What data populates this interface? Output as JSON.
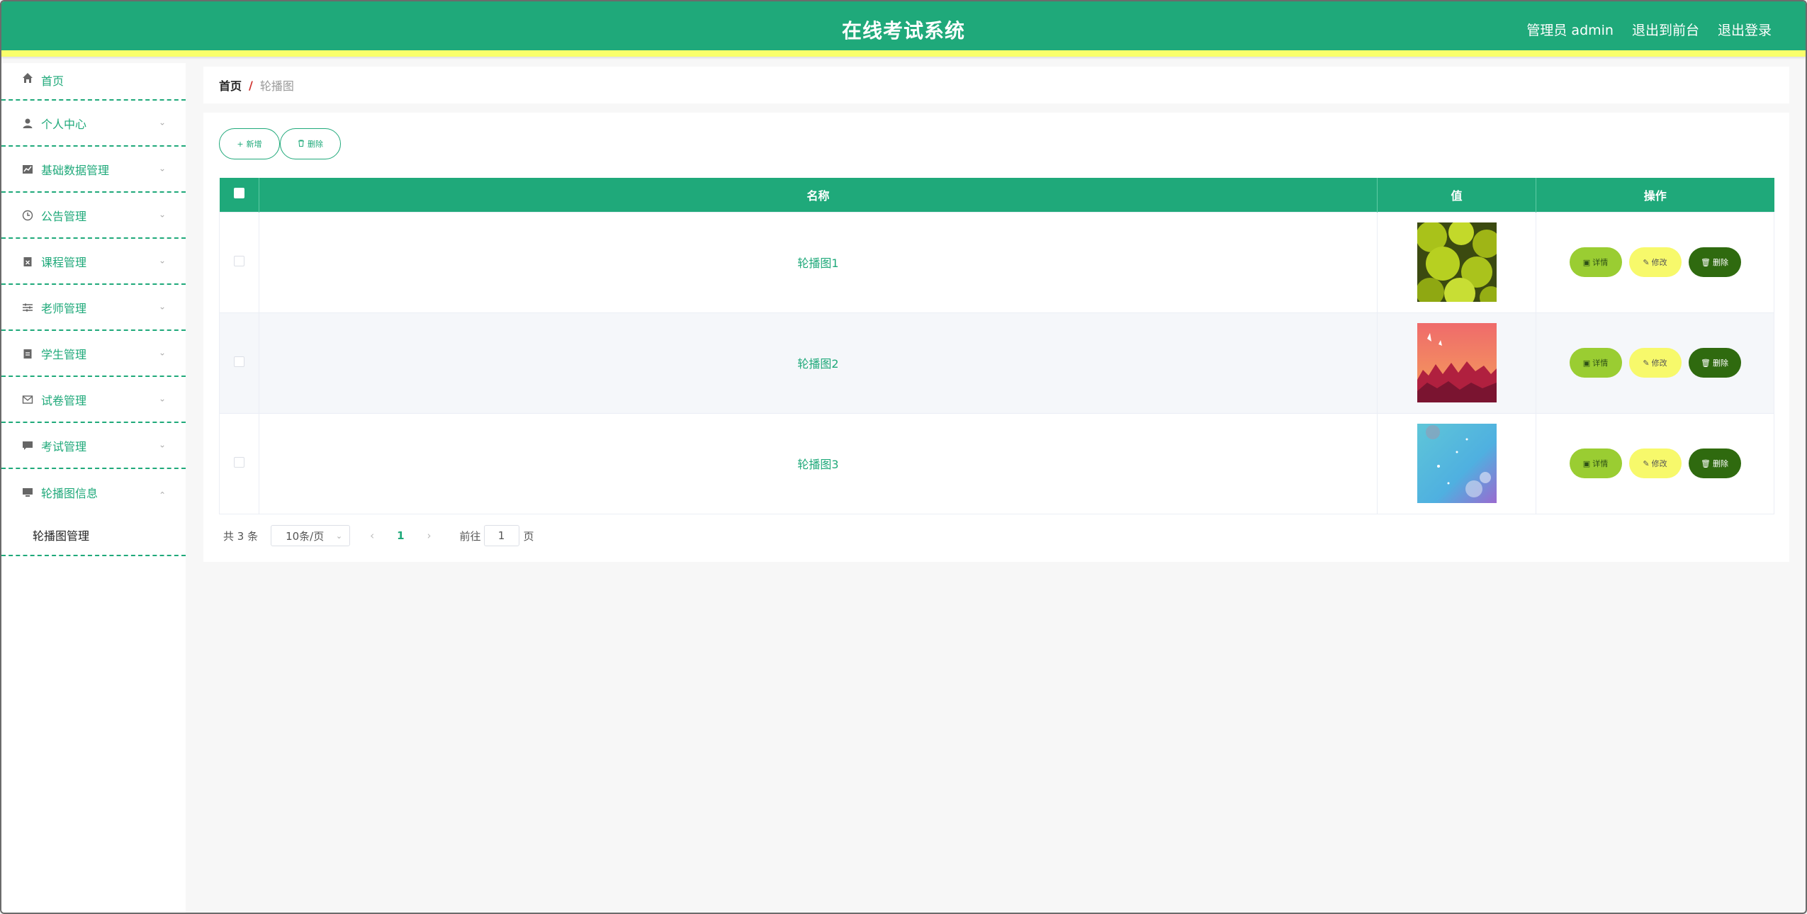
{
  "header": {
    "title": "在线考试系统",
    "user": "管理员 admin",
    "to_front": "退出到前台",
    "logout": "退出登录"
  },
  "colors": {
    "primary": "#1fa97a",
    "accent_strip": "#f9ff6b",
    "detail_btn": "#9acd32",
    "edit_btn": "#f7f96b",
    "delete_btn": "#2f6a0f"
  },
  "sidebar": {
    "items": [
      {
        "label": "首页",
        "icon": "home-icon"
      },
      {
        "label": "个人中心",
        "icon": "user-icon"
      },
      {
        "label": "基础数据管理",
        "icon": "chart-icon"
      },
      {
        "label": "公告管理",
        "icon": "clock-icon"
      },
      {
        "label": "课程管理",
        "icon": "clipboard-x-icon"
      },
      {
        "label": "老师管理",
        "icon": "sliders-icon"
      },
      {
        "label": "学生管理",
        "icon": "clipboard-icon"
      },
      {
        "label": "试卷管理",
        "icon": "mail-icon"
      },
      {
        "label": "考试管理",
        "icon": "chat-icon"
      },
      {
        "label": "轮播图信息",
        "icon": "monitor-icon"
      }
    ],
    "submenu": {
      "label": "轮播图管理"
    }
  },
  "breadcrumb": {
    "home": "首页",
    "sep": "/",
    "current": "轮播图"
  },
  "toolbar": {
    "add_label": "新增",
    "delete_label": "删除"
  },
  "table": {
    "headers": {
      "name": "名称",
      "value": "值",
      "actions": "操作"
    },
    "rows": [
      {
        "name": "轮播图1"
      },
      {
        "name": "轮播图2"
      },
      {
        "name": "轮播图3"
      }
    ],
    "actions": {
      "detail": "详情",
      "edit": "修改",
      "delete": "删除"
    }
  },
  "pagination": {
    "total": "共 3 条",
    "page_size": "10条/页",
    "current_page": "1",
    "goto_label": "前往",
    "goto_value": "1",
    "page_suffix": "页"
  }
}
